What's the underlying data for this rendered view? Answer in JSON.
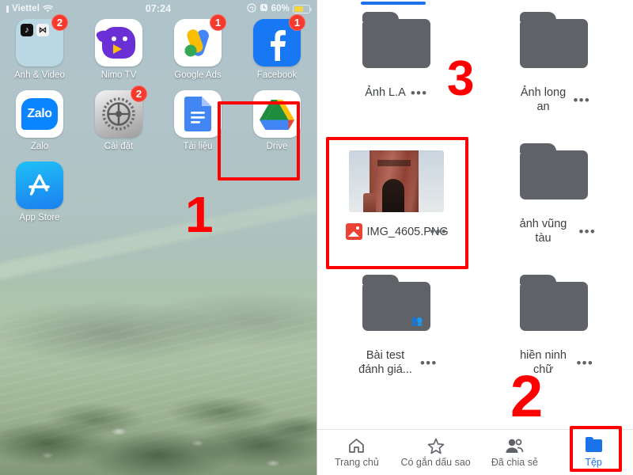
{
  "left_panel": {
    "status_bar": {
      "carrier": "Viettel",
      "wifi_icon": "wifi-icon",
      "time": "07:24",
      "rotation_lock_icon": "rotation-lock-icon",
      "alarm_icon": "alarm-icon",
      "battery_percent": "60%",
      "battery_fill_color": "#f6d543"
    },
    "apps": [
      {
        "label": "Ảnh & Video",
        "icon": "folder-icon",
        "badge": "2",
        "mini_icons": [
          "tiktok-icon",
          "capcut-icon"
        ]
      },
      {
        "label": "Nimo TV",
        "icon": "nimo-tv-icon",
        "badge": null
      },
      {
        "label": "Google Ads",
        "icon": "google-ads-icon",
        "badge": "1"
      },
      {
        "label": "Facebook",
        "icon": "facebook-icon",
        "badge": "1"
      },
      {
        "label": "Zalo",
        "icon": "zalo-icon",
        "badge": null
      },
      {
        "label": "Cài đặt",
        "icon": "settings-icon",
        "badge": "2"
      },
      {
        "label": "Tài liệu",
        "icon": "google-docs-icon",
        "badge": null
      },
      {
        "label": "Drive",
        "icon": "google-drive-icon",
        "badge": null
      },
      {
        "label": "App Store",
        "icon": "app-store-icon",
        "badge": null
      }
    ],
    "annotations": {
      "step_number": "1",
      "highlight_target": "Drive"
    }
  },
  "right_panel": {
    "progress_indicator_color": "#1a73e8",
    "items": [
      {
        "name": "Ảnh L.A",
        "type": "folder",
        "shared": false,
        "menu": "•••"
      },
      {
        "name": "Ảnh long an",
        "type": "folder",
        "shared": false,
        "menu": "•••"
      },
      {
        "name": "IMG_4605.PNG",
        "type": "image",
        "shared": false,
        "menu": "•••",
        "thumbnail": "brick-tower-ruin-photo"
      },
      {
        "name": "ảnh vũng tàu",
        "type": "folder",
        "shared": false,
        "menu": "•••"
      },
      {
        "name": "Bài test đánh giá...",
        "type": "folder",
        "shared": true,
        "menu": "•••"
      },
      {
        "name": "hiền ninh chữ",
        "type": "folder",
        "shared": false,
        "menu": "•••"
      }
    ],
    "bottom_nav": [
      {
        "label": "Trang chủ",
        "icon": "home-icon",
        "active": false
      },
      {
        "label": "Có gắn dấu sao",
        "icon": "star-icon",
        "active": false
      },
      {
        "label": "Đã chia sẻ",
        "icon": "people-icon",
        "active": false
      },
      {
        "label": "Tệp",
        "icon": "folder-icon",
        "active": true
      }
    ],
    "annotations": {
      "step_number_2": "2",
      "step_number_3": "3",
      "highlight_file": "IMG_4605.PNG",
      "highlight_tab": "Tệp"
    }
  },
  "theme": {
    "annotation_color": "#ff0000",
    "drive_accent": "#1a73e8",
    "folder_gray": "#5f6368",
    "badge_red": "#f63a2e"
  }
}
